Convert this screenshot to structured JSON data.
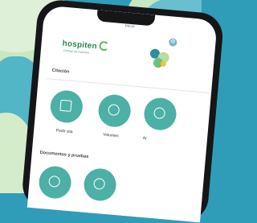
{
  "screen": {
    "title": "Inicio"
  },
  "header": {
    "logo_text": "hospiten",
    "tagline": "Contigo tus expertos"
  },
  "sections": [
    {
      "title": "Citación"
    },
    {
      "title": "Documentos y pruebas"
    }
  ],
  "tiles": [
    {
      "label": "Pedir cita",
      "icon": "calendar-icon"
    },
    {
      "label": "Volumen",
      "icon": "refresh-icon"
    },
    {
      "label": "Ar",
      "icon": "circle-icon"
    },
    {
      "label": "",
      "icon": "clock-icon"
    },
    {
      "label": "",
      "icon": "pulse-icon"
    }
  ],
  "colors": {
    "accent": "#4cb0a6",
    "brand": "#2b8a4a",
    "background": "#2f9db8"
  }
}
